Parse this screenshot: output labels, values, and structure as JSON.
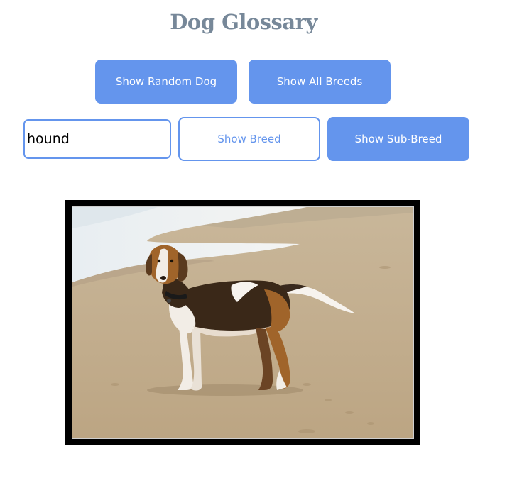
{
  "header": {
    "title": "Dog Glossary"
  },
  "actions": {
    "random_label": "Show Random Dog",
    "all_breeds_label": "Show All Breeds",
    "breed_label": "Show Breed",
    "sub_breed_label": "Show Sub-Breed"
  },
  "search": {
    "value": "hound"
  },
  "image": {
    "subject": "dog-photo",
    "frame_color": "#000000"
  },
  "colors": {
    "accent": "#6495ed",
    "title": "#778899"
  }
}
